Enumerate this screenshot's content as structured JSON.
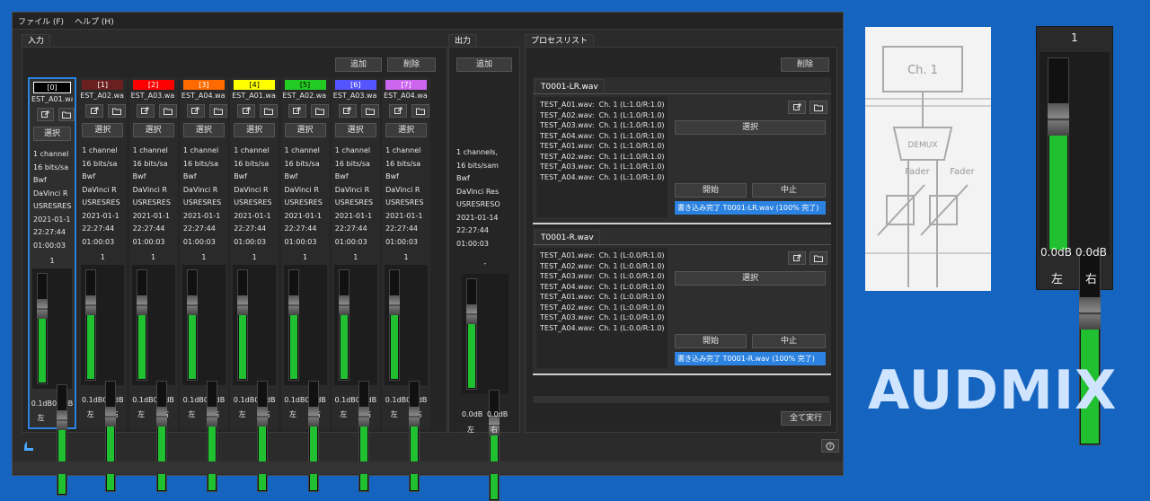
{
  "menu": {
    "file": "ファイル (F)",
    "help": "ヘルプ (H)"
  },
  "input": {
    "title": "入力",
    "add": "追加",
    "delete": "削除",
    "select": "選択",
    "channels": [
      {
        "index": "[0]",
        "color": "#000000",
        "name": "EST_A01.wa",
        "info": [
          "1 channel",
          "16 bits/sa",
          "Bwf",
          "DaVinci R",
          "USRESRES",
          "2021-01-1",
          "22:27:44",
          "01:00:03"
        ],
        "count": "1",
        "db_left": "0.1dB",
        "db_right": "0.0dB",
        "left": "左",
        "right": "右",
        "level": 0.68
      },
      {
        "index": "[1]",
        "color": "#6b2020",
        "name": "EST_A02.wa",
        "info": [
          "1 channel",
          "16 bits/sa",
          "Bwf",
          "DaVinci R",
          "USRESRES",
          "2021-01-1",
          "22:27:44",
          "01:00:03"
        ],
        "count": "1",
        "db_left": "0.1dB",
        "db_right": "0.0dB",
        "left": "左",
        "right": "右",
        "level": 0.68
      },
      {
        "index": "[2]",
        "color": "#ff0000",
        "name": "EST_A03.wa",
        "info": [
          "1 channel",
          "16 bits/sa",
          "Bwf",
          "DaVinci R",
          "USRESRES",
          "2021-01-1",
          "22:27:44",
          "01:00:03"
        ],
        "count": "1",
        "db_left": "0.1dB",
        "db_right": "0.0dB",
        "left": "左",
        "right": "右",
        "level": 0.68
      },
      {
        "index": "[3]",
        "color": "#ff6a00",
        "name": "EST_A04.wa",
        "info": [
          "1 channel",
          "16 bits/sa",
          "Bwf",
          "DaVinci R",
          "USRESRES",
          "2021-01-1",
          "22:27:44",
          "01:00:03"
        ],
        "count": "1",
        "db_left": "0.1dB",
        "db_right": "0.0dB",
        "left": "左",
        "right": "右",
        "level": 0.68
      },
      {
        "index": "[4]",
        "color": "#ffff00",
        "name": "EST_A01.wa",
        "info": [
          "1 channel",
          "16 bits/sa",
          "Bwf",
          "DaVinci R",
          "USRESRES",
          "2021-01-1",
          "22:27:44",
          "01:00:03"
        ],
        "count": "1",
        "db_left": "0.1dB",
        "db_right": "0.0dB",
        "left": "左",
        "right": "右",
        "level": 0.68
      },
      {
        "index": "[5]",
        "color": "#22cc22",
        "name": "EST_A02.wa",
        "info": [
          "1 channel",
          "16 bits/sa",
          "Bwf",
          "DaVinci R",
          "USRESRES",
          "2021-01-1",
          "22:27:44",
          "01:00:03"
        ],
        "count": "1",
        "db_left": "0.1dB",
        "db_right": "0.0dB",
        "left": "左",
        "right": "右",
        "level": 0.68
      },
      {
        "index": "[6]",
        "color": "#5555ff",
        "name": "EST_A03.wa",
        "info": [
          "1 channel",
          "16 bits/sa",
          "Bwf",
          "DaVinci R",
          "USRESRES",
          "2021-01-1",
          "22:27:44",
          "01:00:03"
        ],
        "count": "1",
        "db_left": "0.1dB",
        "db_right": "0.0dB",
        "left": "左",
        "right": "右",
        "level": 0.68
      },
      {
        "index": "[7]",
        "color": "#cc66ee",
        "name": "EST_A04.wa",
        "info": [
          "1 channel",
          "16 bits/sa",
          "Bwf",
          "DaVinci R",
          "USRESRES",
          "2021-01-1",
          "22:27:44",
          "01:00:03"
        ],
        "count": "1",
        "db_left": "0.1dB",
        "db_right": "0.0dB",
        "left": "左",
        "right": "右",
        "level": 0.68
      }
    ]
  },
  "output": {
    "title": "出力",
    "add": "追加",
    "info": [
      "1 channels,",
      "16 bits/sam",
      "Bwf",
      "DaVinci Res",
      "USRESRESO",
      "2021-01-14",
      "22:27:44",
      "01:00:03"
    ],
    "count": "-",
    "db_left": "0.0dB",
    "db_right": "0.0dB",
    "left": "左",
    "right": "右",
    "level": 0.68
  },
  "process": {
    "title": "プロセスリスト",
    "delete": "削除",
    "run_all": "全て実行",
    "items": [
      {
        "file": "T0001-LR.wav",
        "lines": [
          "TEST_A01.wav:  Ch. 1 (L:1.0/R:1.0)",
          "TEST_A02.wav:  Ch. 1 (L:1.0/R:1.0)",
          "TEST_A03.wav:  Ch. 1 (L:1.0/R:1.0)",
          "TEST_A04.wav:  Ch. 1 (L:1.0/R:1.0)",
          "TEST_A01.wav:  Ch. 1 (L:1.0/R:1.0)",
          "TEST_A02.wav:  Ch. 1 (L:1.0/R:1.0)",
          "TEST_A03.wav:  Ch. 1 (L:1.0/R:1.0)",
          "TEST_A04.wav:  Ch. 1 (L:1.0/R:1.0)"
        ],
        "select": "選択",
        "start": "開始",
        "stop": "中止",
        "status": "書き込み完了  T0001-LR.wav (100% 完了)"
      },
      {
        "file": "T0001-R.wav",
        "lines": [
          "TEST_A01.wav:  Ch. 1 (L:0.0/R:1.0)",
          "TEST_A02.wav:  Ch. 1 (L:0.0/R:1.0)",
          "TEST_A03.wav:  Ch. 1 (L:0.0/R:1.0)",
          "TEST_A04.wav:  Ch. 1 (L:0.0/R:1.0)",
          "TEST_A01.wav:  Ch. 1 (L:0.0/R:1.0)",
          "TEST_A02.wav:  Ch. 1 (L:0.0/R:1.0)",
          "TEST_A03.wav:  Ch. 1 (L:0.0/R:1.0)",
          "TEST_A04.wav:  Ch. 1 (L:0.0/R:1.0)"
        ],
        "select": "選択",
        "start": "開始",
        "stop": "中止",
        "status": "書き込み完了  T0001-R.wav (100% 完了)"
      }
    ]
  },
  "diagram": {
    "ch": "Ch. 1",
    "demux": "DEMUX",
    "fader1": "Fader",
    "fader2": "Fader"
  },
  "big_meter": {
    "count": "1",
    "db_left": "0.0dB",
    "db_right": "0.0dB",
    "left": "左",
    "right": "右",
    "level": 0.62
  },
  "brand": "AUDMIX",
  "icons": {
    "open": "open-external-icon",
    "folder": "folder-icon",
    "help": "help-icon",
    "app": "app-logo-icon"
  },
  "colors": {
    "accent": "#2b82e0",
    "meter": "#20c030",
    "background": "#1565c0"
  }
}
